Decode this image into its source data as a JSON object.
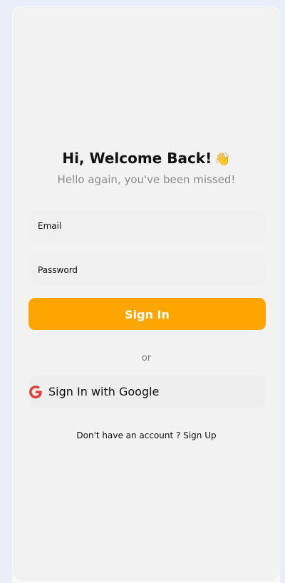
{
  "header": {
    "title": "Hi, Welcome Back!",
    "wave_emoji": "👋",
    "subtitle": "Hello again, you've been missed!"
  },
  "form": {
    "email_placeholder": "Email",
    "password_placeholder": "Password",
    "signin_label": "Sign In"
  },
  "divider": {
    "or_label": "or"
  },
  "social": {
    "google_label": "Sign In with Google",
    "google_icon": "google-icon"
  },
  "footer": {
    "prompt": "Don't have an account ?",
    "signup_label": "Sign Up"
  },
  "colors": {
    "accent": "#ffa500",
    "background": "#e9eef8",
    "card": "#f2f2f2"
  }
}
